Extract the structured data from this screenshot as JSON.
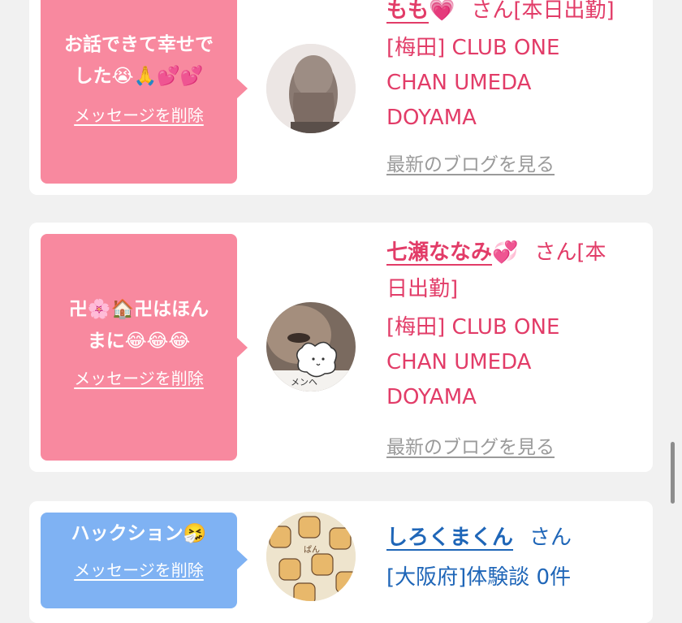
{
  "cards": [
    {
      "message": "お話できて幸せでした😭🙏💕💕",
      "message_line1": "お話できて幸せで",
      "message_line2": "した😭🙏💕💕",
      "delete_label": "メッセージを削除",
      "name": "もも",
      "name_emoji": "💗",
      "san": "さん[本日出勤]",
      "shop_lines": [
        "[梅田] CLUB ONE",
        "CHAN UMEDA",
        "DOYAMA"
      ],
      "blog_label": "最新のブログを見る",
      "bubble_color": "#f8899f",
      "text_color": "#e23c68"
    },
    {
      "message": "卍🌸🏠卍はほんまに😂😂😂",
      "message_line1": "卍🌸🏠卍はほん",
      "message_line2": "まに😂😂😂",
      "delete_label": "メッセージを削除",
      "name": "七瀬ななみ",
      "name_emoji": "💞",
      "san_line1": "さん[本",
      "san_line2": "日出勤]",
      "shop_lines": [
        "[梅田] CLUB ONE",
        "CHAN UMEDA",
        "DOYAMA"
      ],
      "blog_label": "最新のブログを見る",
      "avatar_caption": "メンヘ",
      "bubble_color": "#f8899f",
      "text_color": "#e23c68"
    },
    {
      "message": "ハックション🤧",
      "delete_label": "メッセージを削除",
      "name": "しろくまくん",
      "san": "さん",
      "review_line": "[大阪府]体験談 0件",
      "avatar_text": "ぱん",
      "bubble_color": "#7fb2f3",
      "text_color": "#1f66b8"
    }
  ]
}
